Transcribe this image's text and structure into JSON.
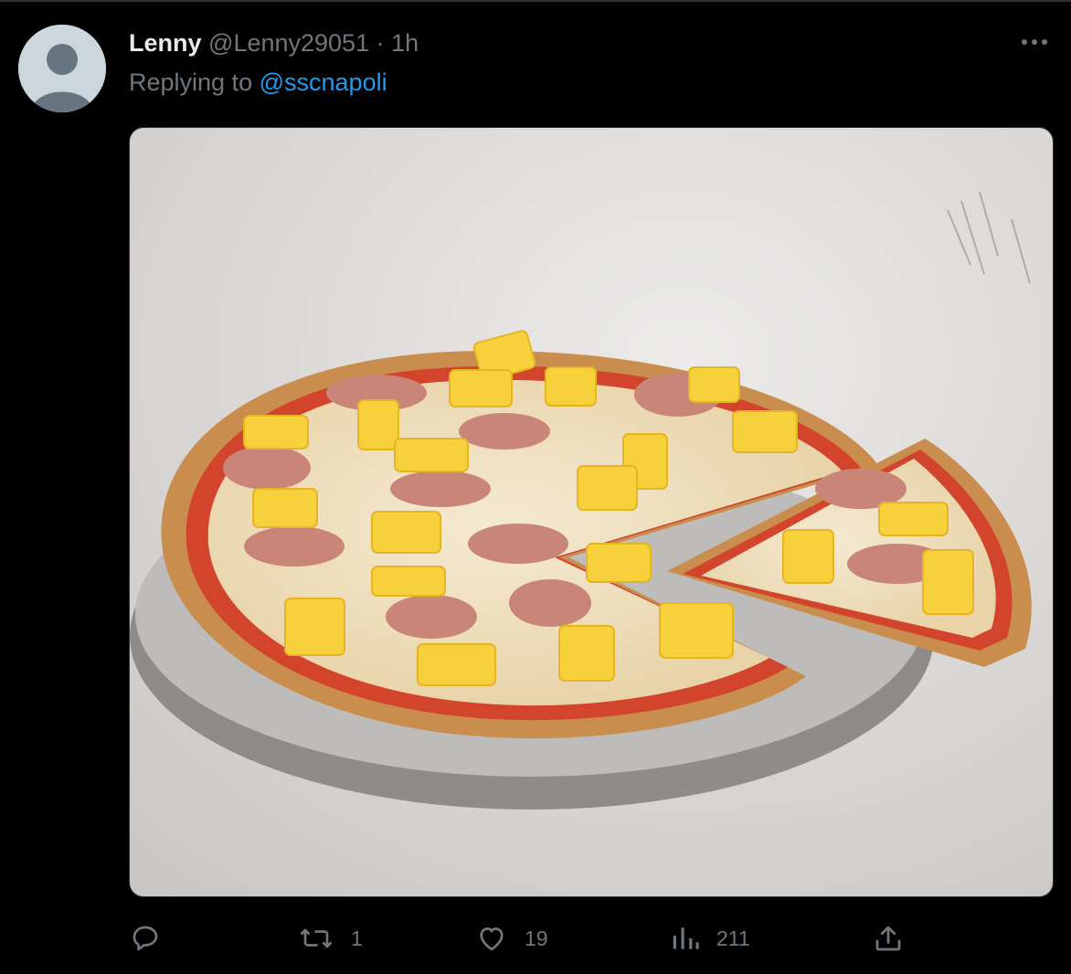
{
  "tweet": {
    "display_name": "Lenny",
    "handle": "@Lenny29051",
    "separator": "·",
    "time": "1h",
    "replying_prefix": "Replying to",
    "replying_to": "@sscnapoli"
  },
  "media": {
    "description_icon": "photo-of-pizza"
  },
  "actions": {
    "reply_count": "",
    "retweet_count": "1",
    "like_count": "19",
    "views_count": "211"
  },
  "colors": {
    "background": "#000000",
    "text_primary": "#e7e9ea",
    "text_secondary": "#71767b",
    "accent": "#1d9bf0",
    "border": "#2f3336"
  }
}
